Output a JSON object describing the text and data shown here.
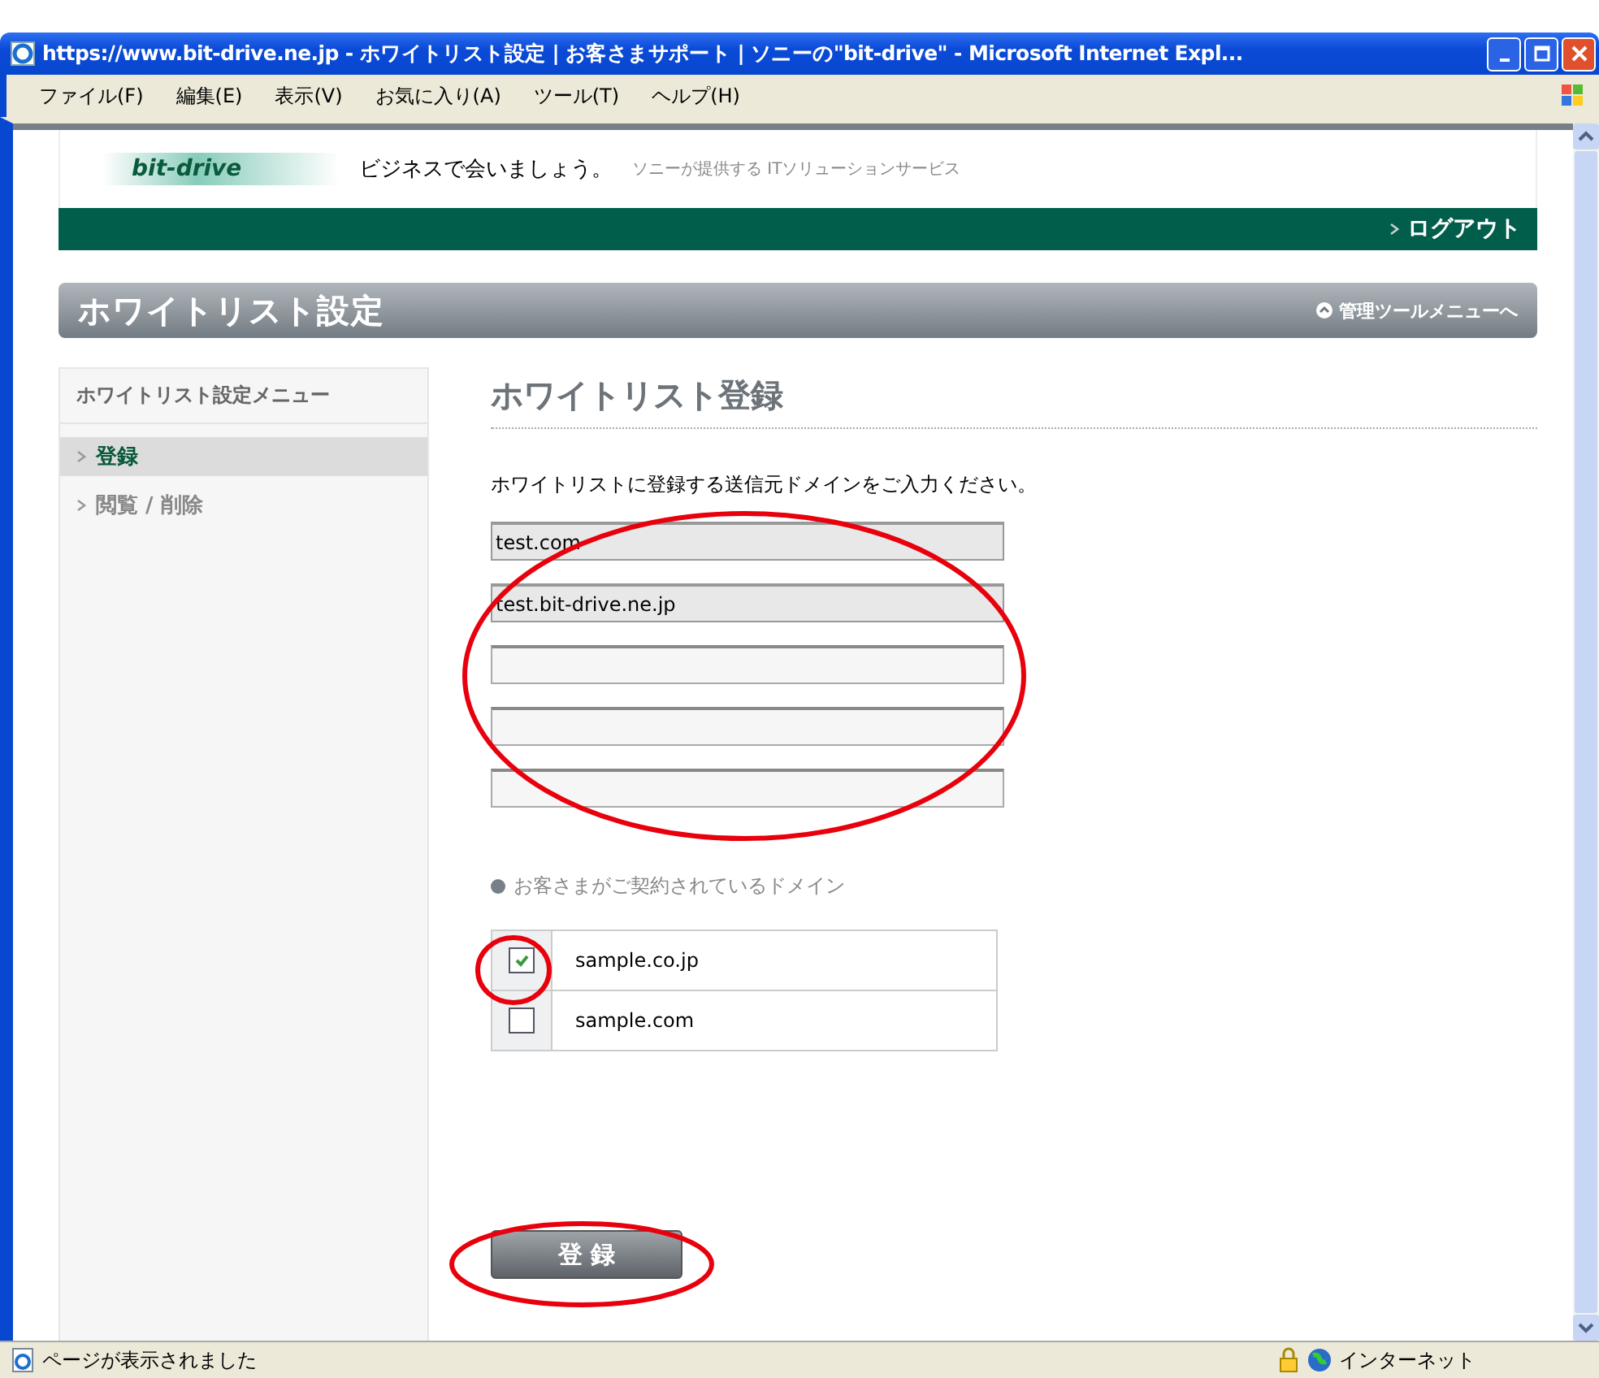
{
  "window": {
    "title": "https://www.bit-drive.ne.jp - ホワイトリスト設定 | お客さまサポート | ソニーの\"bit-drive\" - Microsoft Internet Expl..."
  },
  "menu": [
    "ファイル(F)",
    "編集(E)",
    "表示(V)",
    "お気に入り(A)",
    "ツール(T)",
    "ヘルプ(H)"
  ],
  "header": {
    "logo": "bit-drive",
    "tagline": "ビジネスで会いましょう。",
    "subtagline": "ソニーが提供する ITソリューションサービス",
    "logout": "ログアウト"
  },
  "page_title": "ホワイトリスト設定",
  "tool_menu_link": "管理ツールメニューへ",
  "sidebar": {
    "title": "ホワイトリスト設定メニュー",
    "items": [
      {
        "label": "登録",
        "selected": true
      },
      {
        "label": "閲覧 / 削除",
        "selected": false
      }
    ]
  },
  "main": {
    "heading": "ホワイトリスト登録",
    "instruction": "ホワイトリストに登録する送信元ドメインをご入力ください。",
    "fields": [
      {
        "empty": false,
        "value": "test.com"
      },
      {
        "empty": false,
        "value": "test.bit-drive.ne.jp"
      },
      {
        "empty": true
      },
      {
        "empty": true
      },
      {
        "empty": true
      }
    ],
    "contracted_label": "お客さまがご契約されているドメイン",
    "domains": [
      {
        "name": "sample.co.jp",
        "checked": true
      },
      {
        "name": "sample.com",
        "checked": false
      }
    ],
    "submit": "登 録"
  },
  "status_bar": {
    "text": "ページが表示されました",
    "zone": "インターネット"
  }
}
